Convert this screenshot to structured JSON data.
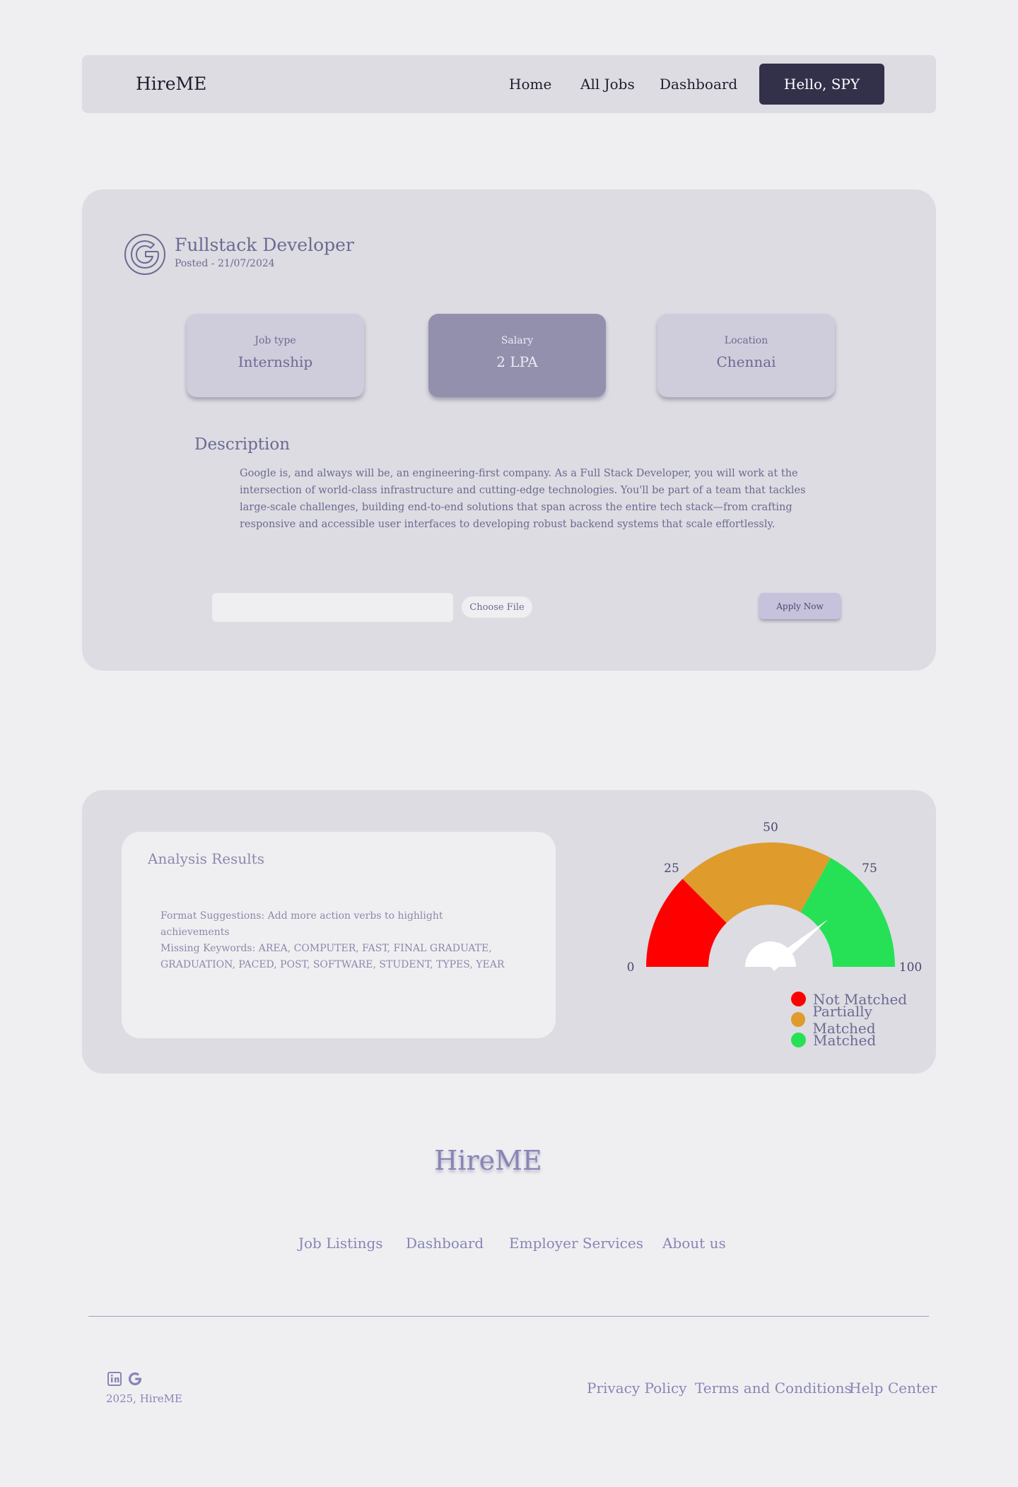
{
  "navbar": {
    "brand": "HireME",
    "links": [
      "Home",
      "All Jobs",
      "Dashboard"
    ],
    "user_button": "Hello, SPY"
  },
  "job": {
    "company_icon": "google-icon",
    "title": "Fullstack Developer",
    "posted": "Posted - 21/07/2024",
    "tiles": [
      {
        "label": "Job type",
        "value": "Internship"
      },
      {
        "label": "Salary",
        "value": "2 LPA"
      },
      {
        "label": "Location",
        "value": "Chennai"
      }
    ],
    "description_heading": "Description",
    "description": "Google is, and always will be, an engineering-first company. As a Full Stack Developer, you will work at the intersection of world-class infrastructure and cutting-edge technologies. You'll be part of a team that tackles large-scale challenges, building end-to-end solutions that span across the entire tech stack—from crafting responsive and accessible user interfaces to developing robust backend systems that scale effortlessly.",
    "file_input_value": "",
    "choose_file": "Choose File",
    "apply_button": "Apply Now"
  },
  "analysis": {
    "title": "Analysis Results",
    "lines": [
      "Format Suggestions: Add more action verbs to highlight achievements",
      "Missing Keywords: AREA, COMPUTER, FAST, FINAL GRADUATE, GRADUATION, PACED, POST, SOFTWARE, STUDENT, TYPES, YEAR"
    ],
    "gauge": {
      "value": 78,
      "min": 0,
      "max": 100,
      "ticks": [
        "0",
        "25",
        "50",
        "75",
        "100"
      ],
      "segments": [
        {
          "from": 0,
          "to": 25,
          "color": "#ff0000"
        },
        {
          "from": 25,
          "to": 66,
          "color": "#e09b2d"
        },
        {
          "from": 66,
          "to": 100,
          "color": "#26e155"
        }
      ]
    },
    "legend": [
      {
        "label": "Not Matched",
        "color": "#ff0000"
      },
      {
        "label": "Partially Matched",
        "color": "#e09b2d"
      },
      {
        "label": "Matched",
        "color": "#26e155"
      }
    ]
  },
  "footer": {
    "brand": "HireME",
    "links": [
      "Job Listings",
      "Dashboard",
      "Employer Services",
      "About us"
    ],
    "social_icons": [
      "linkedin-icon",
      "google-icon"
    ],
    "copyright": "2025, HireME",
    "legal_links": [
      "Privacy Policy",
      "Terms and Conditions",
      "Help Center"
    ]
  }
}
